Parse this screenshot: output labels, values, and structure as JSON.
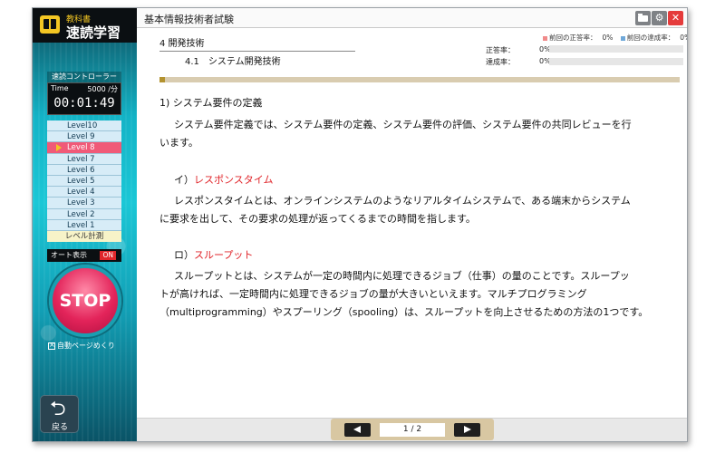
{
  "app": {
    "brand_small": "教科書",
    "brand_big": "速読学習"
  },
  "controller": {
    "title": "速読コントローラー",
    "time_label": "Time",
    "speed": "5000 /分",
    "clock": "00:01:49",
    "levels": [
      "Level10",
      "Level 9",
      "Level 8",
      "Level 7",
      "Level 6",
      "Level 5",
      "Level 4",
      "Level 3",
      "Level 2",
      "Level 1"
    ],
    "active_level": "Level 8",
    "measure_label": "レベル計測",
    "auto_display_label": "オート表示",
    "auto_display_state": "ON",
    "stop_label": "STOP",
    "auto_page_label": "自動ページめくり",
    "back_label": "戻る"
  },
  "window": {
    "title": "基本情報技術者試験"
  },
  "header": {
    "chapter": "4 開発技術",
    "section": "4.1　システム開発技術",
    "legend_prev_correct": "前回の正答率：",
    "legend_prev_correct_value": "0%",
    "legend_prev_achieve": "前回の達成率：",
    "legend_prev_achieve_value": "0%",
    "correct_label": "正答率：",
    "correct_value": "0%",
    "correct_rate": 0,
    "achieve_label": "達成率：",
    "achieve_value": "0%",
    "achieve_rate": 0
  },
  "content": {
    "heading": "1) システム要件の定義",
    "para1_line1": "システム要件定義では、システム要件の定義、システム要件の評価、システム要件の共同レビューを行",
    "para1_line2": "います。",
    "sub1_prefix": "イ）",
    "sub1_title": "レスポンスタイム",
    "para2_line1": "レスポンスタイムとは、オンラインシステムのようなリアルタイムシステムで、ある端末からシステム",
    "para2_line2": "に要求を出して、その要求の処理が返ってくるまでの時間を指します。",
    "sub2_prefix": "ロ）",
    "sub2_title": "スループット",
    "para3_line1": "スループットとは、システムが一定の時間内に処理できるジョブ（仕事）の量のことです。スループッ",
    "para3_line2": "トが高ければ、一定時間内に処理できるジョブの量が大きいといえます。マルチプログラミング",
    "para3_line3": "（multiprogramming）やスプーリング（spooling）は、スループットを向上させるための方法の1つです。"
  },
  "pager": {
    "indicator": "1 / 2"
  },
  "colors": {
    "accent_red": "#e0262b",
    "active_level": "#f05a78",
    "stop": "#e3245a",
    "sidebar": "#13b3c6"
  }
}
